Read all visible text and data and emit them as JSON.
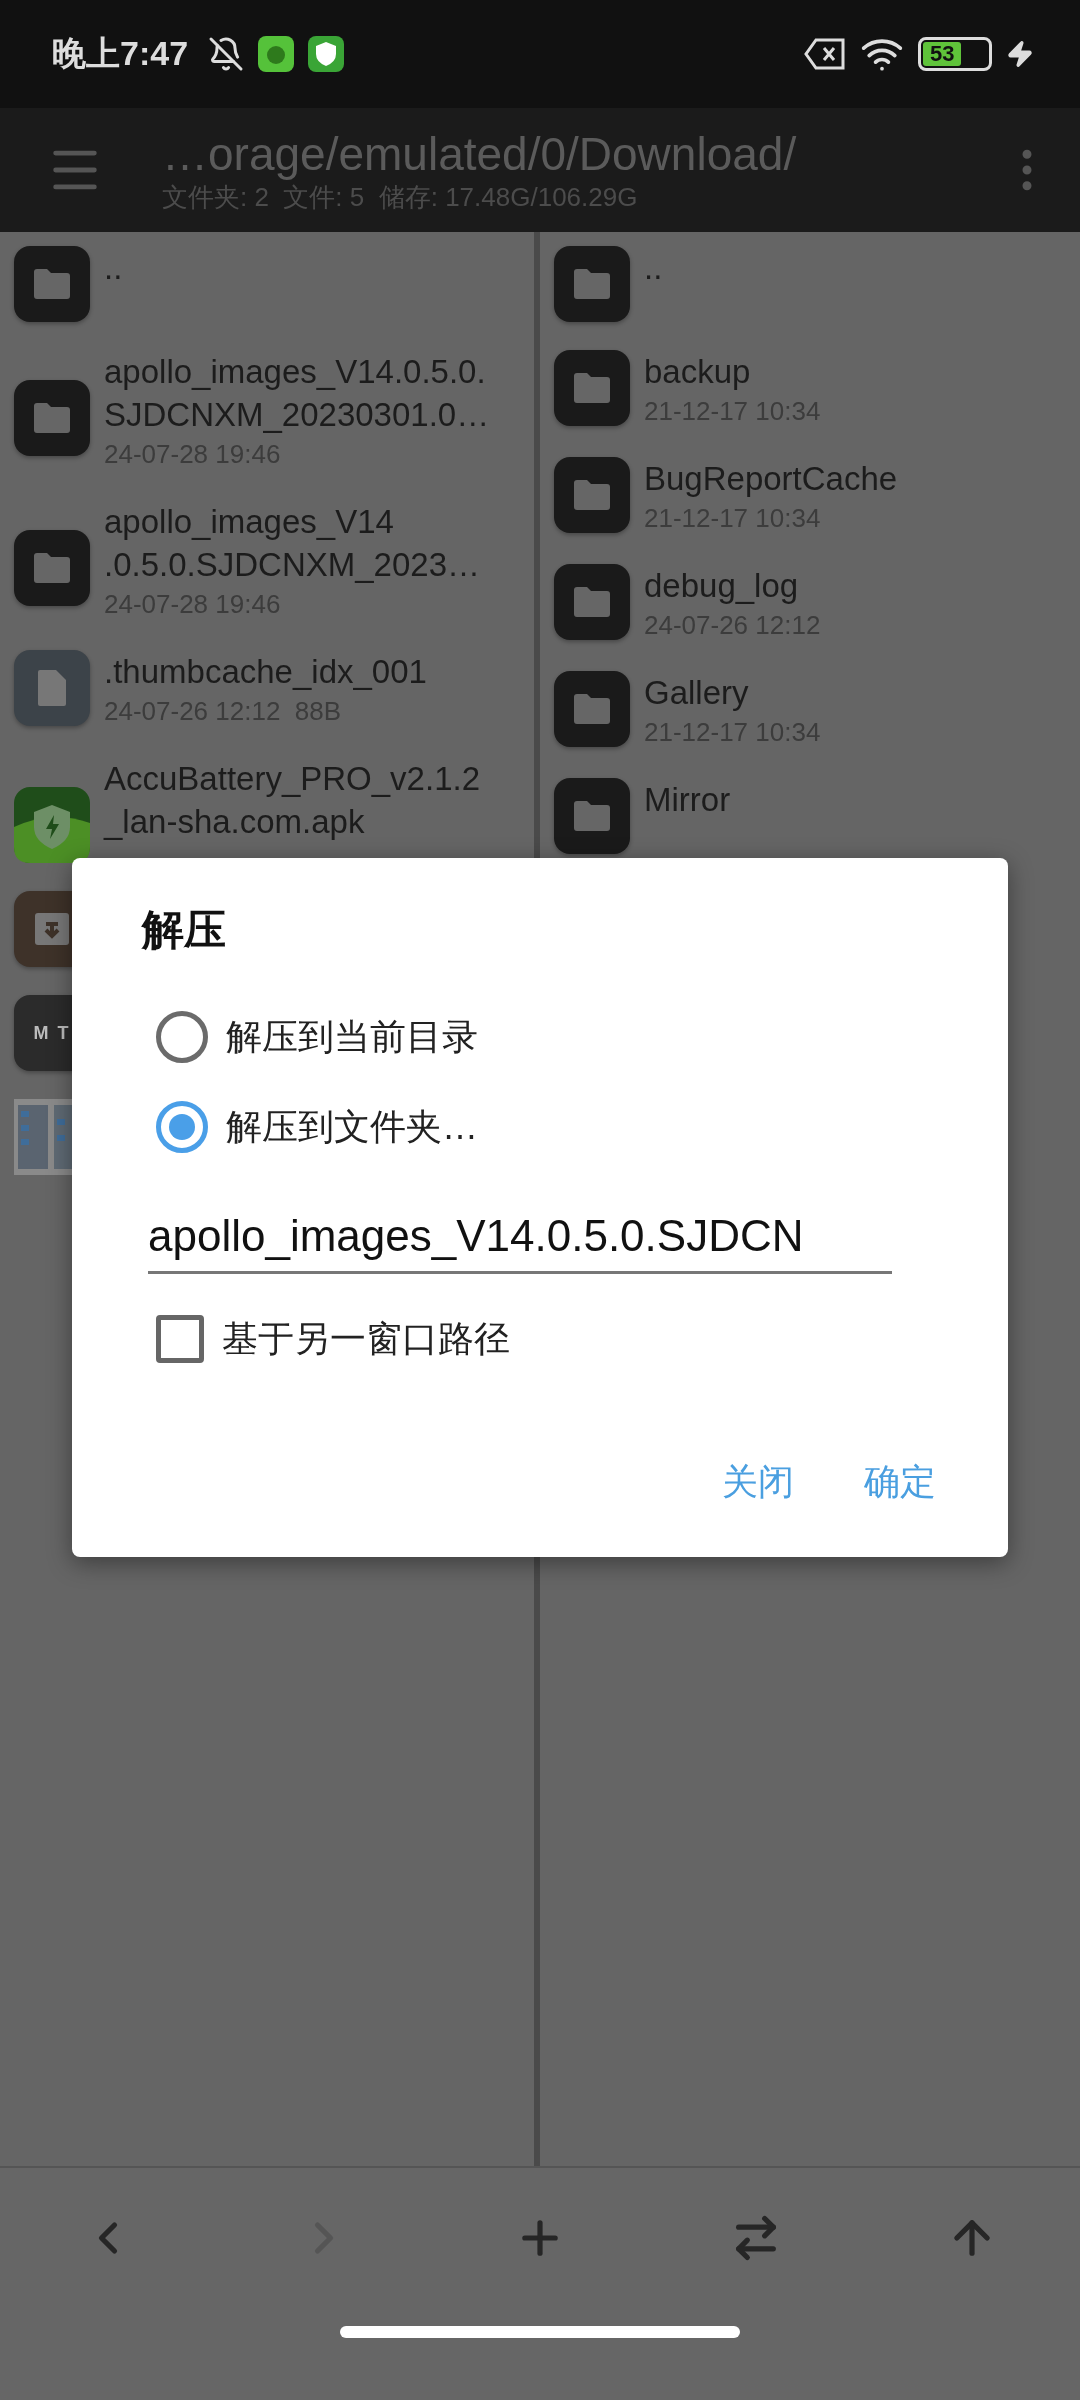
{
  "status_bar": {
    "time": "晚上7:47",
    "battery": "53"
  },
  "header": {
    "title": "…orage/emulated/0/Download/",
    "subtitle": "文件夹: 2  文件: 5  储存: 17.48G/106.29G"
  },
  "panels": [
    {
      "items": [
        {
          "kind": "folder",
          "name": ".."
        },
        {
          "kind": "folder",
          "name": "apollo_images_V14.0.5.0.\nSJDCNXM_20230301.0…",
          "date": "24-07-28 19:46"
        },
        {
          "kind": "folder",
          "name": "apollo_images_V14\n.0.5.0.SJDCNXM_2023…",
          "date": "24-07-28 19:46"
        },
        {
          "kind": "file",
          "name": ".thumbcache_idx_001",
          "date": "24-07-26 12:12",
          "size": "88B"
        },
        {
          "kind": "apk",
          "name": "AccuBattery_PRO_v2.1.2\n_lan-sha.com.apk"
        },
        {
          "kind": "archive"
        },
        {
          "kind": "app",
          "icon_text": "M T"
        },
        {
          "kind": "picture"
        }
      ]
    },
    {
      "items": [
        {
          "kind": "folder",
          "name": ".."
        },
        {
          "kind": "folder",
          "name": "backup",
          "date": "21-12-17 10:34"
        },
        {
          "kind": "folder",
          "name": "BugReportCache",
          "date": "21-12-17 10:34"
        },
        {
          "kind": "folder",
          "name": "debug_log",
          "date": "24-07-26 12:12"
        },
        {
          "kind": "folder",
          "name": "Gallery",
          "date": "21-12-17 10:34"
        },
        {
          "kind": "folder",
          "name": "Mirror"
        }
      ]
    }
  ],
  "dialog": {
    "title": "解压",
    "options": [
      {
        "label": "解压到当前目录",
        "selected": false
      },
      {
        "label": "解压到文件夹…",
        "selected": true
      }
    ],
    "field": {
      "value": "apollo_images_V14.0.5.0.SJDCN"
    },
    "checkbox": {
      "label": "基于另一窗口路径",
      "checked": false
    },
    "buttons": [
      "关闭",
      "确定"
    ]
  },
  "toolbar": [
    {
      "kind": "back",
      "disabled": false
    },
    {
      "kind": "forward",
      "disabled": true
    },
    {
      "kind": "add",
      "disabled": false
    },
    {
      "kind": "swap",
      "disabled": false
    },
    {
      "kind": "up",
      "disabled": false
    }
  ]
}
